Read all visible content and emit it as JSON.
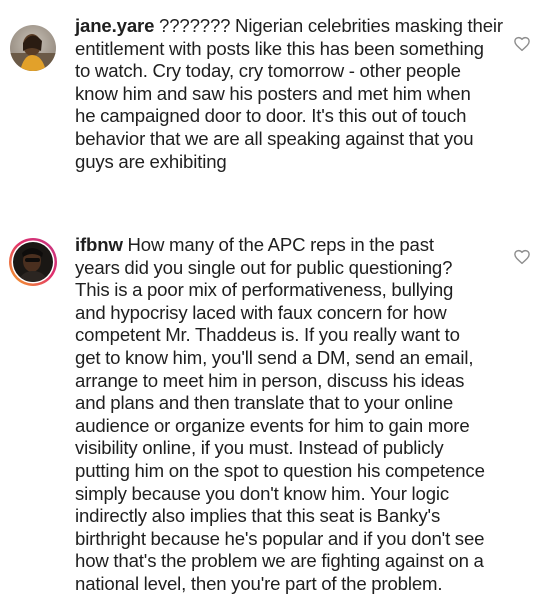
{
  "comments": [
    {
      "username": "jane.yare",
      "avatar": "avatar-photo",
      "like_icon": "heart-outline-icon",
      "lines": [
        "??????? Nigerian celebrities masking their",
        "entitlement with posts like this has been something",
        "to watch. Cry today, cry tomorrow - other people",
        "know him and saw his posters and met him when",
        "he campaigned door to door. It's this out of touch",
        "behavior that we are all speaking against that you",
        "guys are exhibiting"
      ]
    },
    {
      "username": "ifbnw",
      "avatar": "avatar-photo-with-story-ring",
      "like_icon": "heart-outline-icon",
      "lines": [
        "How many of the APC reps in the past",
        "years did you single out for public questioning?",
        "This is a poor mix of performativeness, bullying",
        "and hypocrisy laced with faux concern for how",
        "competent Mr. Thaddeus is. If you really want to",
        "get to know him, you'll send a DM, send an email,",
        "arrange to meet him in person, discuss his ideas",
        "and plans and then translate that to your online",
        "audience or organize events for him to gain more",
        "visibility online, if you must. Instead of publicly",
        "putting him on the spot to question his competence",
        "simply because you don't know him. Your logic",
        "indirectly also implies that this seat is Banky's",
        "birthright because he's popular and if you don't see",
        "how that's the problem we are fighting against on a",
        "national level, then you're part of the problem."
      ]
    }
  ],
  "colors": {
    "text": "#1f1f1f",
    "icon": "#8e8e8e",
    "story_ring_start": "#f5a623",
    "story_ring_end": "#c13584"
  }
}
